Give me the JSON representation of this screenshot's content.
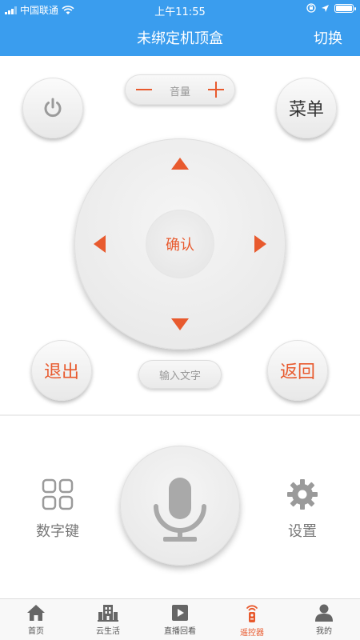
{
  "status_bar": {
    "carrier": "中国联通",
    "time": "上午11:55"
  },
  "header": {
    "title": "未绑定机顶盒",
    "switch_label": "切换"
  },
  "remote": {
    "menu_label": "菜单",
    "volume_label": "音量",
    "ok_label": "确认",
    "exit_label": "退出",
    "back_label": "返回",
    "input_text_label": "输入文字"
  },
  "tools": {
    "numpad_label": "数字键",
    "settings_label": "设置"
  },
  "tabs": [
    {
      "label": "首页",
      "icon": "home-icon"
    },
    {
      "label": "云生活",
      "icon": "building-icon"
    },
    {
      "label": "直播回看",
      "icon": "play-icon"
    },
    {
      "label": "遥控器",
      "icon": "remote-icon",
      "active": true
    },
    {
      "label": "我的",
      "icon": "person-icon"
    }
  ],
  "colors": {
    "header_bg": "#3a9dee",
    "accent": "#e85a2e",
    "icon_gray": "#9a9a9a"
  }
}
